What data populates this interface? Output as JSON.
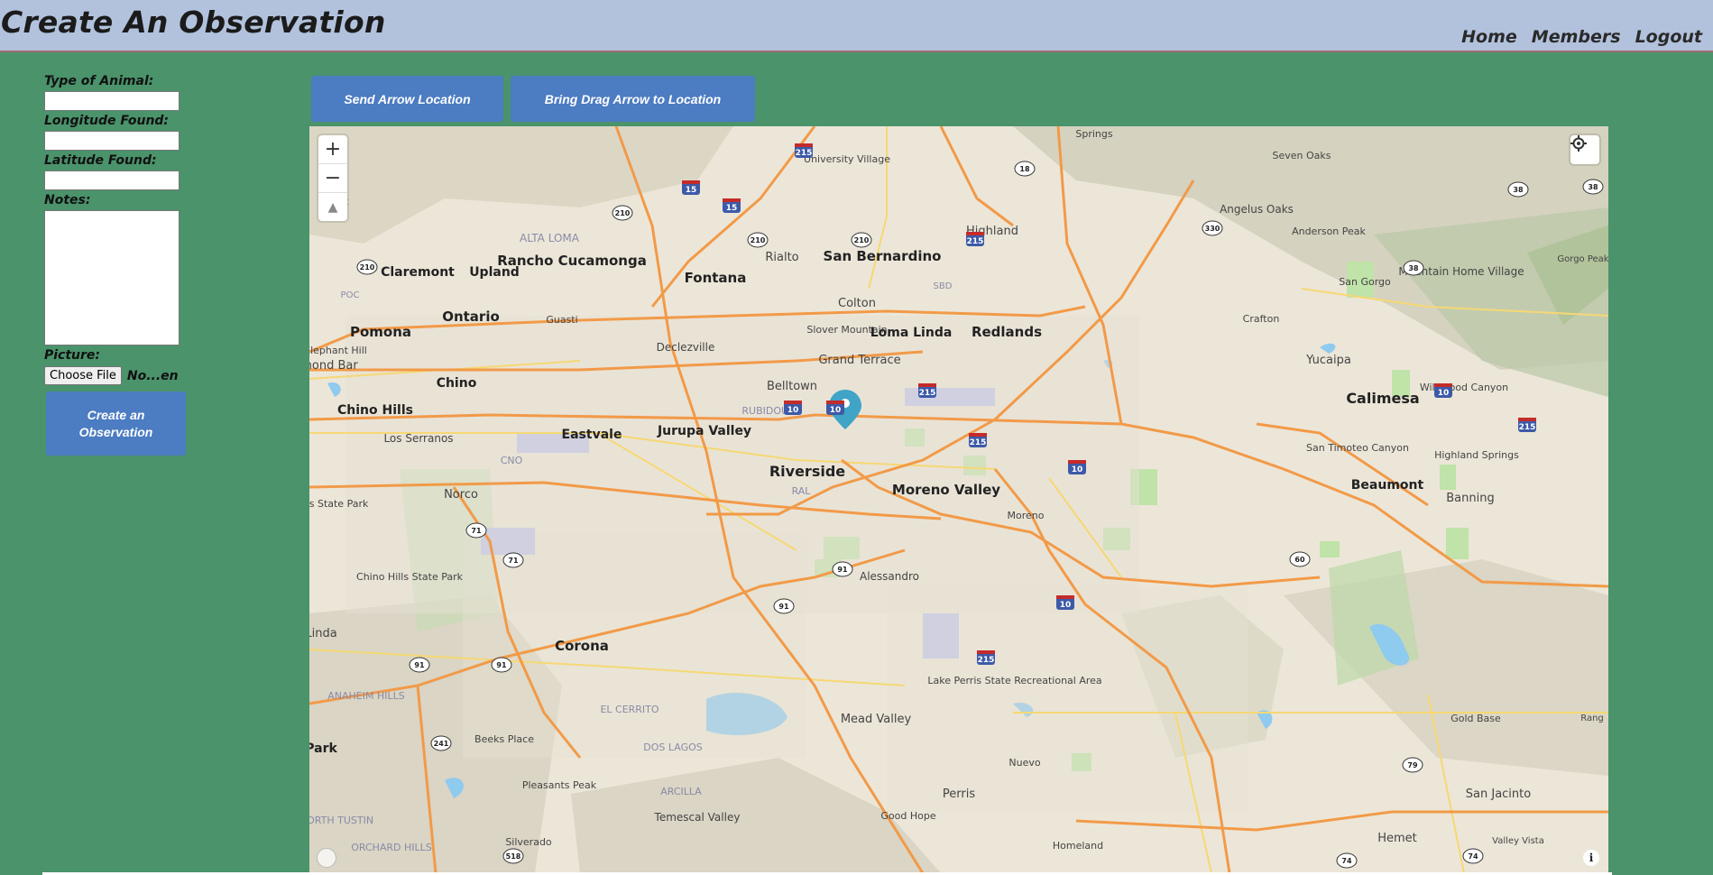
{
  "header": {
    "title": "Create An Observation",
    "nav": [
      "Home",
      "Members",
      "Logout"
    ]
  },
  "form": {
    "animal_label": "Type of Animal:",
    "longitude_label": "Longitude Found:",
    "latitude_label": "Latitude Found:",
    "notes_label": "Notes:",
    "picture_label": "Picture:",
    "file_button": "Choose File",
    "file_status": "No...en",
    "submit_label": "Create an Observation"
  },
  "map_controls": {
    "send_label": "Send Arrow Location",
    "bring_label": "Bring Drag Arrow to Location",
    "zoom_in": "+",
    "zoom_out": "−",
    "compass": "▲",
    "info": "i"
  },
  "map": {
    "cities": [
      "Springs",
      "Seven Oaks",
      "University Village",
      "Angelus Oaks",
      "Highland",
      "Anderson Peak",
      "ALTA LOMA",
      "Rancho Cucamonga",
      "Rialto",
      "San Bernardino",
      "Claremont",
      "Upland",
      "Fontana",
      "POC",
      "SBD",
      "Mountain Home Village",
      "San Gorgo",
      "Crafton",
      "Ontario",
      "Guasti",
      "Colton",
      "Pomona",
      "Slover Mountain",
      "Loma Linda",
      "Redlands",
      "Elephant Hill",
      "Declezville",
      "Yucaipa",
      "mond Bar",
      "Grand Terrace",
      "Wildwood Canyon",
      "Chino",
      "Belltown",
      "Calimesa",
      "RUBIDOUX",
      "Chino Hills",
      "Jurupa Valley",
      "Los Serranos",
      "Eastvale",
      "San Timoteo Canyon",
      "Highland Springs",
      "CNO",
      "Riverside",
      "RAL",
      "Moreno Valley",
      "Norco",
      "ls State Park",
      "Beaumont",
      "Banning",
      "Moreno",
      "Chino Hills State Park",
      "Linda",
      "Alessandro",
      "Corona",
      "ANAHEIM HILLS",
      "Lake Perris State Recreational Area",
      "EL CERRITO",
      "Mead Valley",
      "Gold Base",
      "Rang",
      "Park",
      "Beeks Place",
      "DOS LAGOS",
      "Nuevo",
      "Pleasants Peak",
      "ARCILLA",
      "Perris",
      "San Jacinto",
      "NORTH TUSTIN",
      "Temescal Valley",
      "Good Hope",
      "ORCHARD HILLS",
      "Silverado",
      "Homeland",
      "Hemet",
      "Valley Vista",
      "Gorgo Peak",
      "Peak"
    ],
    "shields_interstate": [
      "15",
      "215",
      "15",
      "215",
      "10",
      "10",
      "10",
      "215",
      "215",
      "10",
      "215",
      "215",
      "10"
    ],
    "shields_state": [
      "18",
      "330",
      "38",
      "38",
      "38",
      "210",
      "210",
      "210",
      "210",
      "71",
      "71",
      "91",
      "91",
      "91",
      "91",
      "60",
      "241",
      "79",
      "74",
      "74",
      "518"
    ]
  }
}
